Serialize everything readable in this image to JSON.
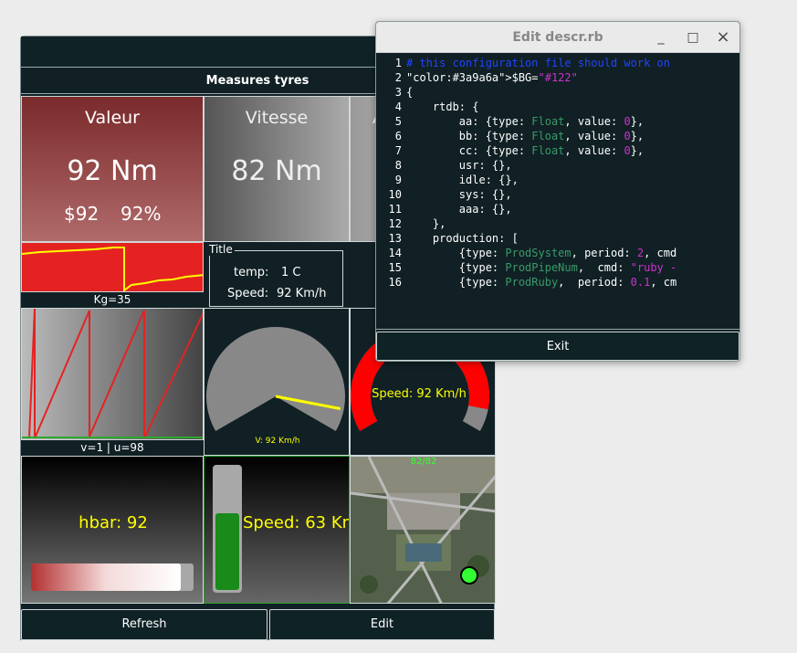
{
  "dashboard": {
    "header": "Measures tyres",
    "valeur": {
      "label": "Valeur",
      "value": "92 Nm",
      "price": "$92",
      "percent": "92%"
    },
    "vitesse": {
      "label": "Vitesse",
      "value": "82 Nm"
    },
    "third": {
      "label": "A"
    },
    "kg_label": "Kg=35",
    "groupbox": {
      "title": "Title",
      "rows": [
        {
          "key": "temp:",
          "val": "1 C"
        },
        {
          "key": "Speed:",
          "val": "92 Km/h"
        }
      ]
    },
    "saw_label": "v=1 | u=98",
    "gauge_needle": {
      "label": "V: 92 Km/h",
      "level": 0.92
    },
    "gauge_arc": {
      "label": "Speed: 92 Km/h",
      "level": 0.92
    },
    "hbar": {
      "label": "hbar: 92",
      "level": 0.92
    },
    "vbar": {
      "label": "Speed: 63 Km/h",
      "level": 0.63
    },
    "map": {
      "caption": "82/82"
    },
    "refresh_label": "Refresh",
    "edit_label": "Edit"
  },
  "editor": {
    "title": "Edit descr.rb",
    "minimize": "_",
    "maximize": "□",
    "close": "×",
    "exit_label": "Exit",
    "lines": [
      {
        "n": "1",
        "t": "# this configuration file should work on"
      },
      {
        "n": "2",
        "t": "$BG=\"#122\""
      },
      {
        "n": "3",
        "t": "{"
      },
      {
        "n": "4",
        "t": "    rtdb: {"
      },
      {
        "n": "5",
        "t": "        aa: {type: Float, value: 0},"
      },
      {
        "n": "6",
        "t": "        bb: {type: Float, value: 0},"
      },
      {
        "n": "7",
        "t": "        cc: {type: Float, value: 0},"
      },
      {
        "n": "8",
        "t": "        usr: {},"
      },
      {
        "n": "9",
        "t": "        idle: {},"
      },
      {
        "n": "10",
        "t": "        sys: {},"
      },
      {
        "n": "11",
        "t": "        aaa: {},"
      },
      {
        "n": "12",
        "t": "    },"
      },
      {
        "n": "13",
        "t": "    production: ["
      },
      {
        "n": "14",
        "t": "        {type: ProdSystem, period: 2, cmd"
      },
      {
        "n": "15",
        "t": "        {type: ProdPipeNum,  cmd: \"ruby -"
      },
      {
        "n": "16",
        "t": "        {type: ProdRuby,  period: 0.1, cm"
      }
    ]
  },
  "colors": {
    "bg": "#102024",
    "red": "#e52222",
    "yellow": "#ffff00",
    "green": "#1a8a1a",
    "comment": "#2244ff",
    "type": "#3a9a6a",
    "number": "#cc33cc",
    "string": "#cc33cc"
  }
}
